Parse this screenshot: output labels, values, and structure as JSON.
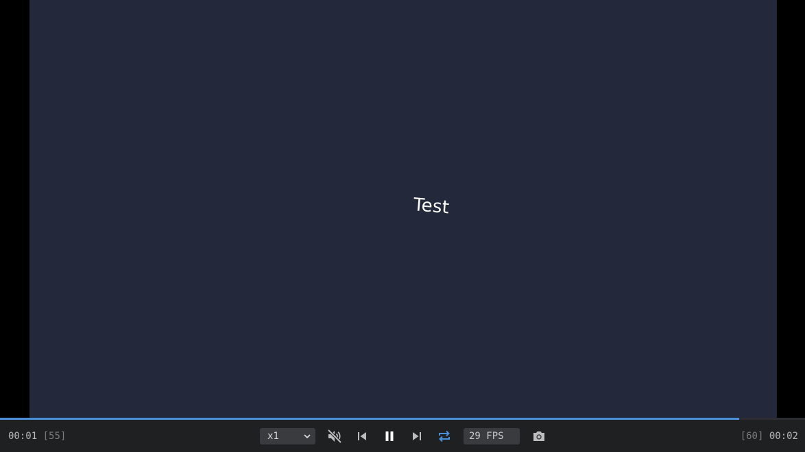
{
  "canvas": {
    "text": "Test",
    "background": "#23283a"
  },
  "playback": {
    "current_time": "00:01",
    "current_frame": "[55]",
    "total_frame": "[60]",
    "total_time": "00:02",
    "progress_fraction": 0.918
  },
  "controls": {
    "speed_value": "x1",
    "fps_value": "29 FPS",
    "icons": {
      "mute": "volume-off-icon",
      "prev": "skip-previous-icon",
      "pause": "pause-icon",
      "next": "skip-next-icon",
      "loop": "repeat-icon",
      "screenshot": "camera-icon"
    },
    "loop_color": "#4a90d9"
  }
}
